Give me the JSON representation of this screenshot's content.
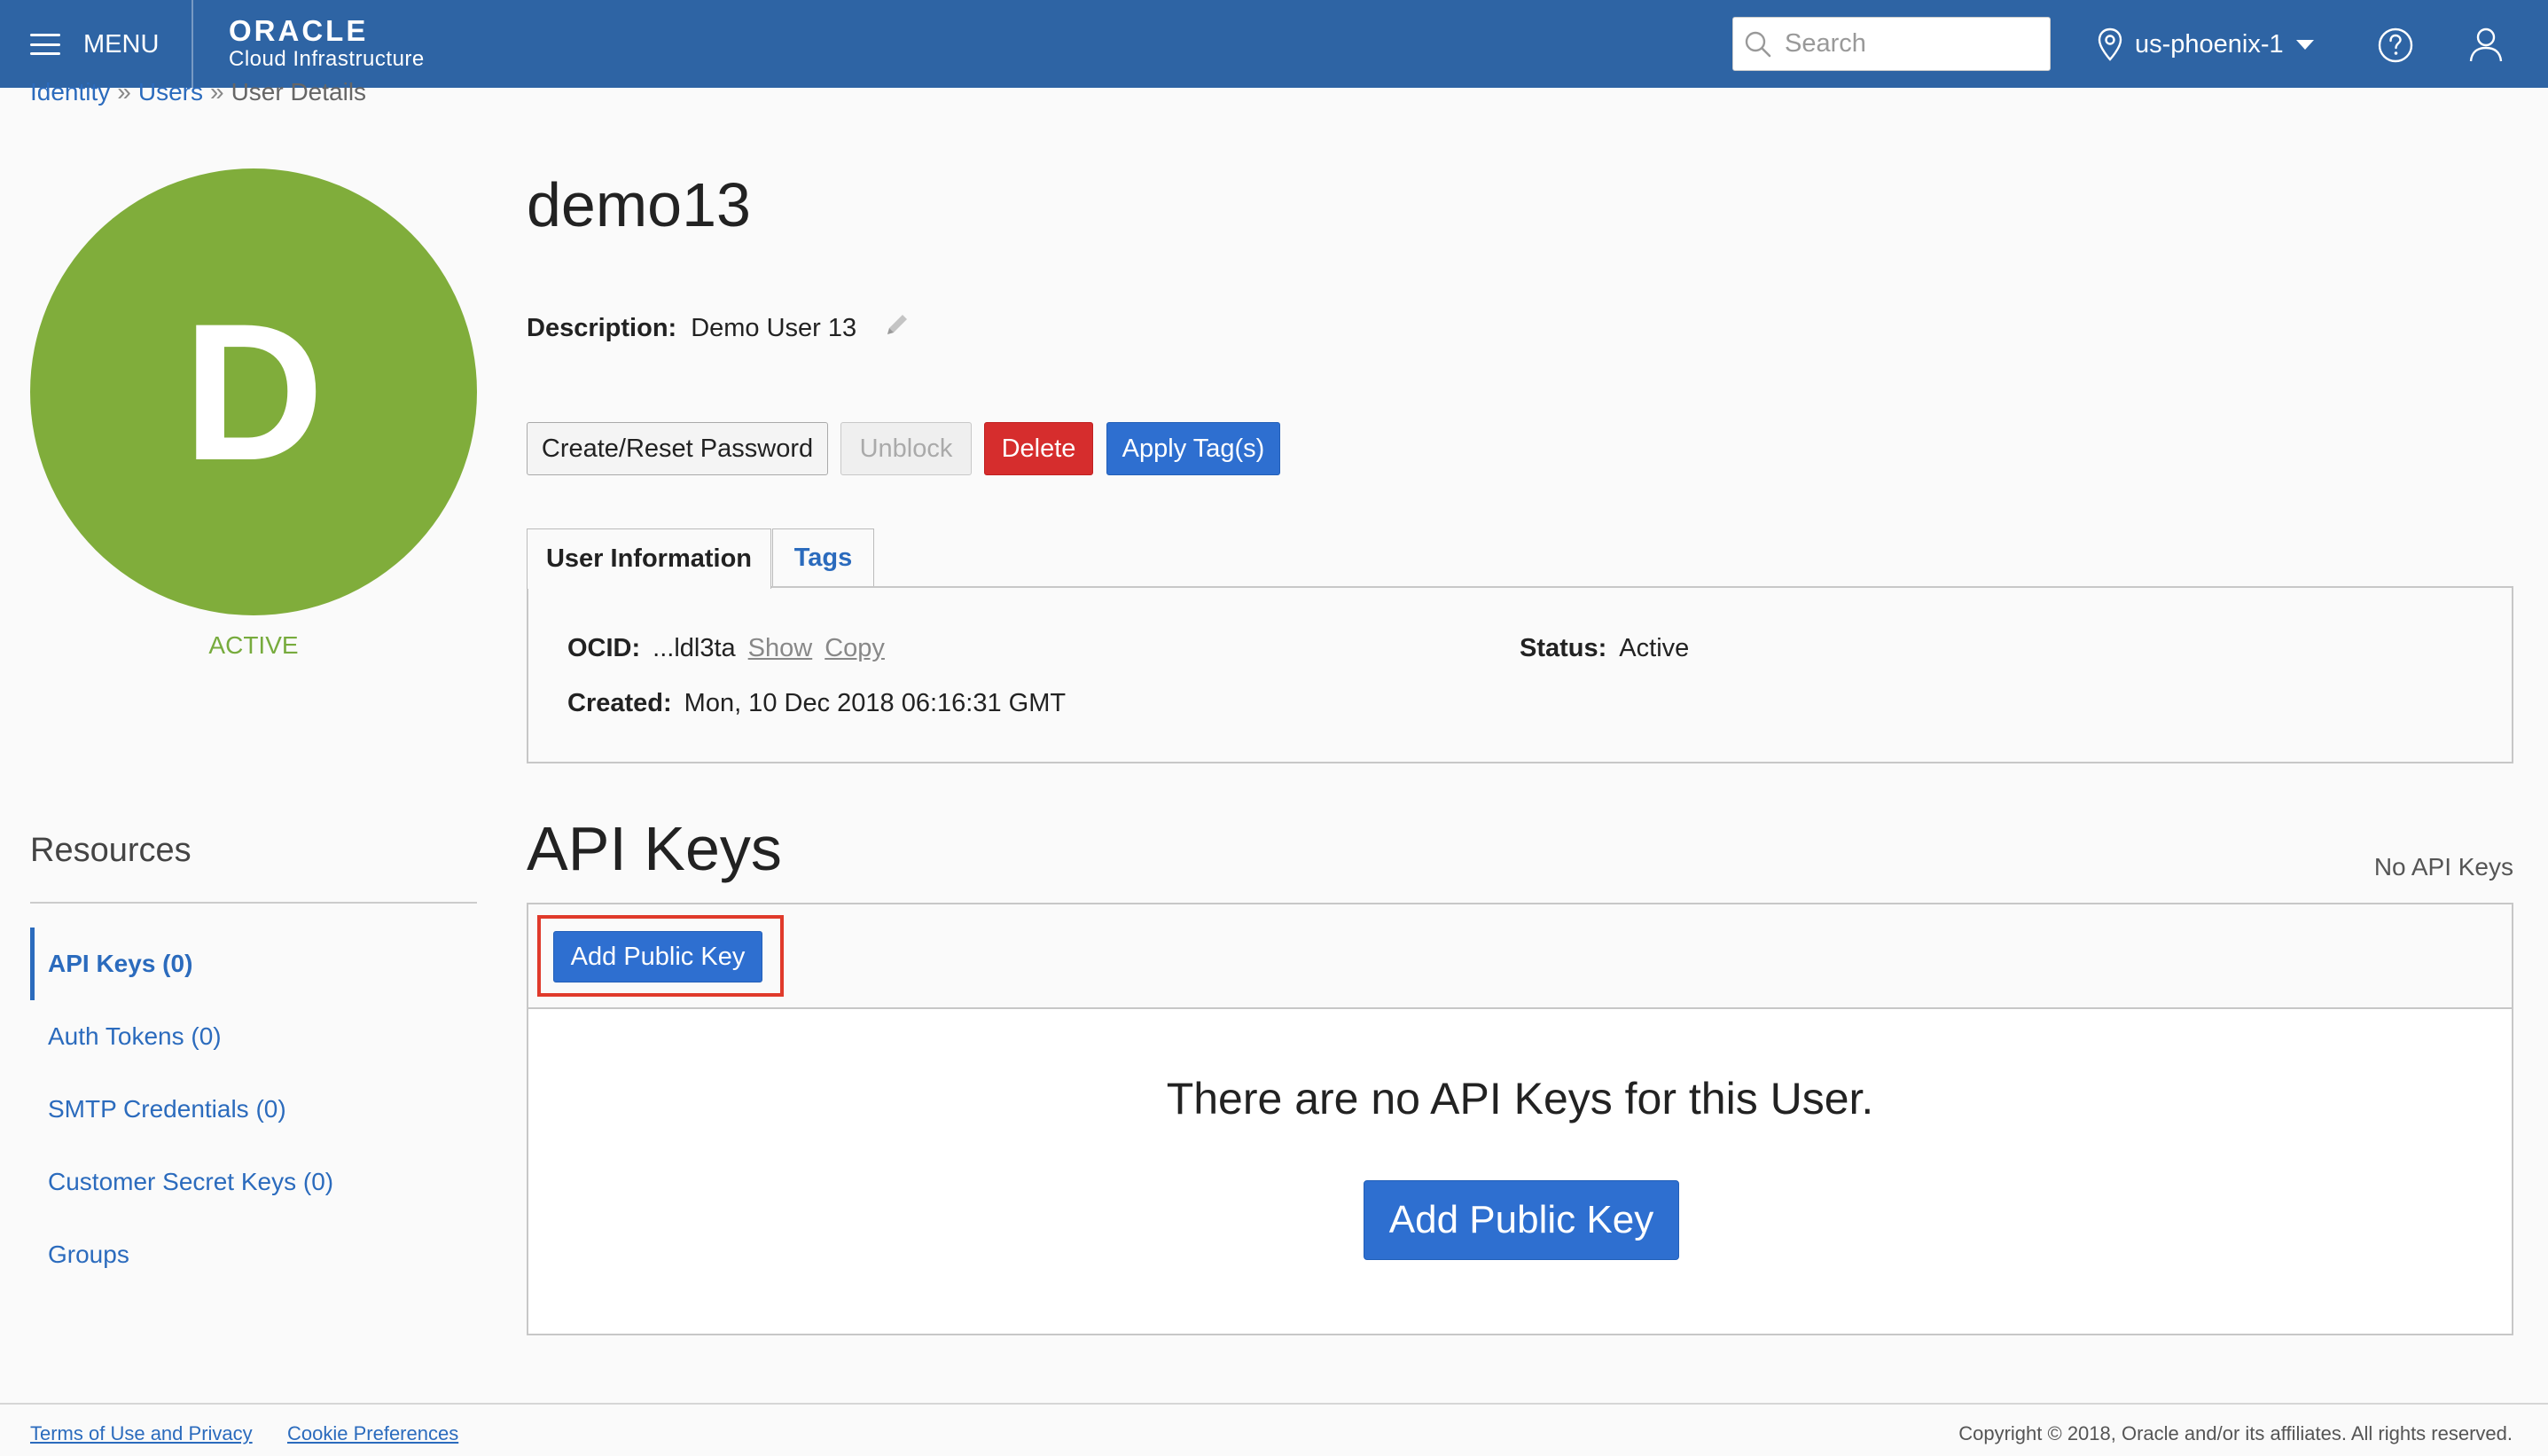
{
  "header": {
    "menu_label": "MENU",
    "brand_logo": "ORACLE",
    "brand_sub": "Cloud Infrastructure",
    "search_placeholder": "Search",
    "region": "us-phoenix-1",
    "bg_color": "#2e64a4"
  },
  "breadcrumb": {
    "items": [
      "Identity",
      "Users",
      "User Details"
    ],
    "separator": "»"
  },
  "user": {
    "initial": "D",
    "state": "ACTIVE",
    "avatar_color": "#80ad3b",
    "name": "demo13",
    "description_label": "Description:",
    "description": "Demo User 13"
  },
  "actions": {
    "reset_password": "Create/Reset Password",
    "unblock": "Unblock",
    "delete": "Delete",
    "apply_tags": "Apply Tag(s)"
  },
  "tabs": {
    "info": "User Information",
    "tags": "Tags"
  },
  "info": {
    "ocid_label": "OCID:",
    "ocid_value": "...ldl3ta",
    "show": "Show",
    "copy": "Copy",
    "created_label": "Created:",
    "created_value": "Mon, 10 Dec 2018 06:16:31 GMT",
    "status_label": "Status:",
    "status_value": "Active"
  },
  "resources": {
    "heading": "Resources",
    "items": [
      "API Keys (0)",
      "Auth Tokens (0)",
      "SMTP Credentials (0)",
      "Customer Secret Keys (0)",
      "Groups"
    ]
  },
  "api_keys": {
    "heading": "API Keys",
    "count_text": "No API Keys",
    "add_button": "Add Public Key",
    "empty_message": "There are no API Keys for this User.",
    "empty_add_button": "Add Public Key",
    "highlight_color": "#e03a2b"
  },
  "footer": {
    "terms": "Terms of Use and Privacy",
    "cookies": "Cookie Preferences",
    "copyright": "Copyright © 2018, Oracle and/or its affiliates. All rights reserved."
  }
}
